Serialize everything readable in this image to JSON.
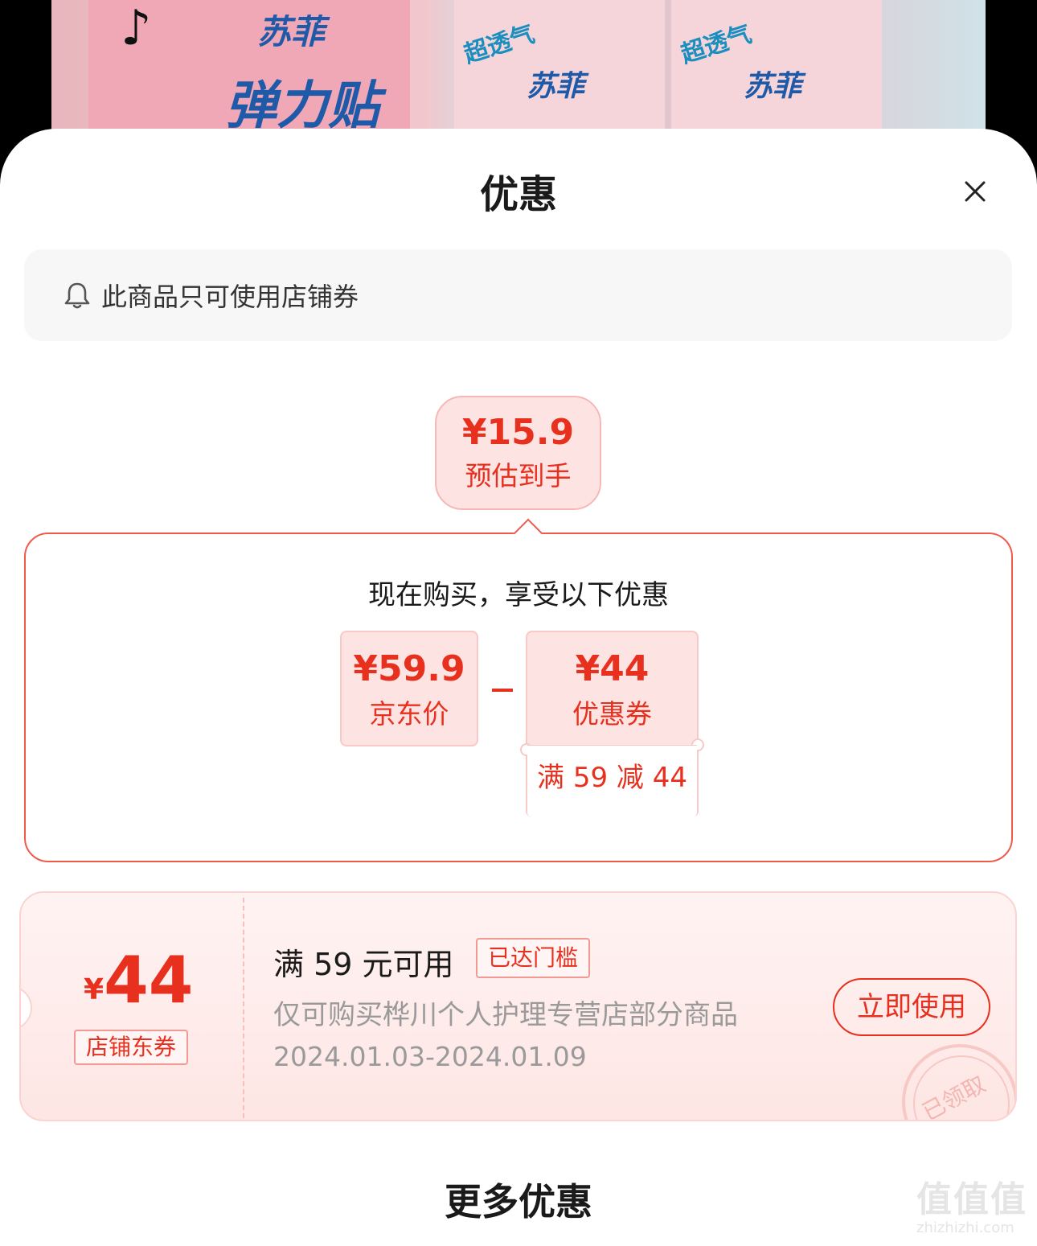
{
  "hero": {
    "brand": "苏菲",
    "slogan": "弹力贴身",
    "air_tag": "超透气"
  },
  "sheet": {
    "title": "优惠",
    "close_icon": "close-icon"
  },
  "notice": {
    "icon": "bell-icon",
    "text": "此商品只可使用店铺券"
  },
  "estimate": {
    "price": "¥15.9",
    "label": "预估到手"
  },
  "breakdown": {
    "title": "现在购买，享受以下优惠",
    "jd_price": "¥59.9",
    "jd_price_label": "京东价",
    "coupon_value": "¥44",
    "coupon_label": "优惠券",
    "coupon_condition": "满 59 减 44"
  },
  "coupon": {
    "currency": "¥",
    "amount": "44",
    "type": "店铺东券",
    "condition": "满 59 元可用",
    "badge": "已达门槛",
    "scope": "仅可购买桦川个人护理专营店部分商品",
    "period": "2024.01.03-2024.01.09",
    "use_button": "立即使用",
    "stamp": "已领取"
  },
  "more_title": "更多优惠",
  "watermark": {
    "cn": "值值值",
    "url": "zhizhizhi.com"
  },
  "colors": {
    "accent": "#e8301f",
    "pink_bg": "#fde4e3",
    "gray_text": "#9a9a9a"
  }
}
